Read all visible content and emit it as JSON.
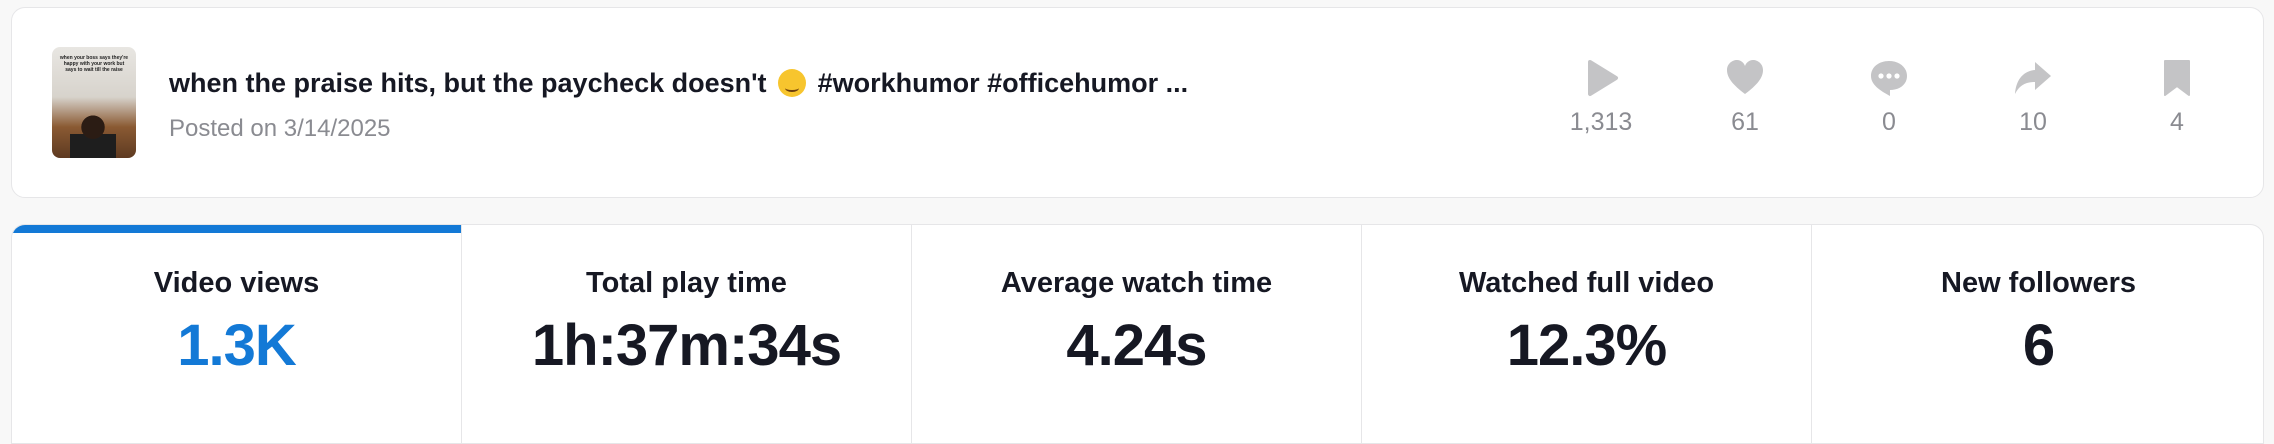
{
  "post": {
    "title_text": "when the praise hits, but the paycheck doesn't",
    "title_emoji": "upside-down-face",
    "title_tags": "#workhumor #officehumor ...",
    "posted": "Posted on 3/14/2025",
    "thumbnail_caption": "when your boss says they're happy with your work but says to wait till the raise"
  },
  "stats": [
    {
      "icon": "play-icon",
      "value": "1,313"
    },
    {
      "icon": "heart-icon",
      "value": "61"
    },
    {
      "icon": "comment-icon",
      "value": "0"
    },
    {
      "icon": "share-icon",
      "value": "10"
    },
    {
      "icon": "bookmark-icon",
      "value": "4"
    }
  ],
  "metrics": [
    {
      "label": "Video views",
      "value": "1.3K",
      "active": true
    },
    {
      "label": "Total play time",
      "value": "1h:37m:34s"
    },
    {
      "label": "Average watch time",
      "value": "4.24s"
    },
    {
      "label": "Watched full video",
      "value": "12.3%"
    },
    {
      "label": "New followers",
      "value": "6"
    }
  ],
  "colors": {
    "accent": "#1379d6",
    "icon_gray": "#c4c4c6",
    "muted_text": "#8a8b91"
  }
}
